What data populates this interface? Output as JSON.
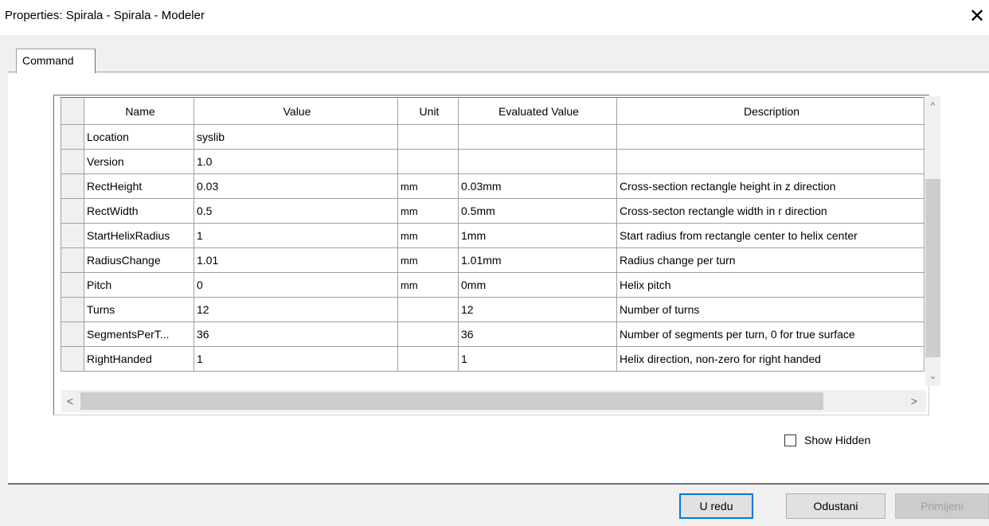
{
  "window": {
    "title": "Properties: Spirala - Spirala - Modeler",
    "close_glyph": "✕"
  },
  "tabs": [
    {
      "label": "Command",
      "active": true
    }
  ],
  "grid": {
    "columns": [
      "Name",
      "Value",
      "Unit",
      "Evaluated Value",
      "Description"
    ],
    "rows": [
      {
        "name": "Location",
        "value": "syslib",
        "unit": "",
        "evaluated": "",
        "description": ""
      },
      {
        "name": "Version",
        "value": "1.0",
        "unit": "",
        "evaluated": "",
        "description": ""
      },
      {
        "name": "RectHeight",
        "value": "0.03",
        "unit": "mm",
        "evaluated": "0.03mm",
        "description": "Cross-section rectangle height in z direction"
      },
      {
        "name": "RectWidth",
        "value": "0.5",
        "unit": "mm",
        "evaluated": "0.5mm",
        "description": "Cross-secton rectangle width in r direction"
      },
      {
        "name": "StartHelixRadius",
        "value": "1",
        "unit": "mm",
        "evaluated": "1mm",
        "description": "Start radius from rectangle center to helix center"
      },
      {
        "name": "RadiusChange",
        "value": "1.01",
        "unit": "mm",
        "evaluated": "1.01mm",
        "description": "Radius change per turn"
      },
      {
        "name": "Pitch",
        "value": "0",
        "unit": "mm",
        "evaluated": "0mm",
        "description": "Helix pitch"
      },
      {
        "name": "Turns",
        "value": "12",
        "unit": "",
        "evaluated": "12",
        "description": "Number of turns"
      },
      {
        "name": "SegmentsPerT...",
        "value": "36",
        "unit": "",
        "evaluated": "36",
        "description": "Number of segments per turn, 0 for true surface"
      },
      {
        "name": "RightHanded",
        "value": "1",
        "unit": "",
        "evaluated": "1",
        "description": "Helix direction, non-zero for right handed"
      }
    ]
  },
  "scrollbars": {
    "up": "^",
    "down": "⌄",
    "left": "<",
    "right": ">"
  },
  "show_hidden": {
    "label": "Show Hidden",
    "checked": false
  },
  "buttons": {
    "ok": "U redu",
    "cancel": "Odustani",
    "apply": "Primijeni"
  }
}
